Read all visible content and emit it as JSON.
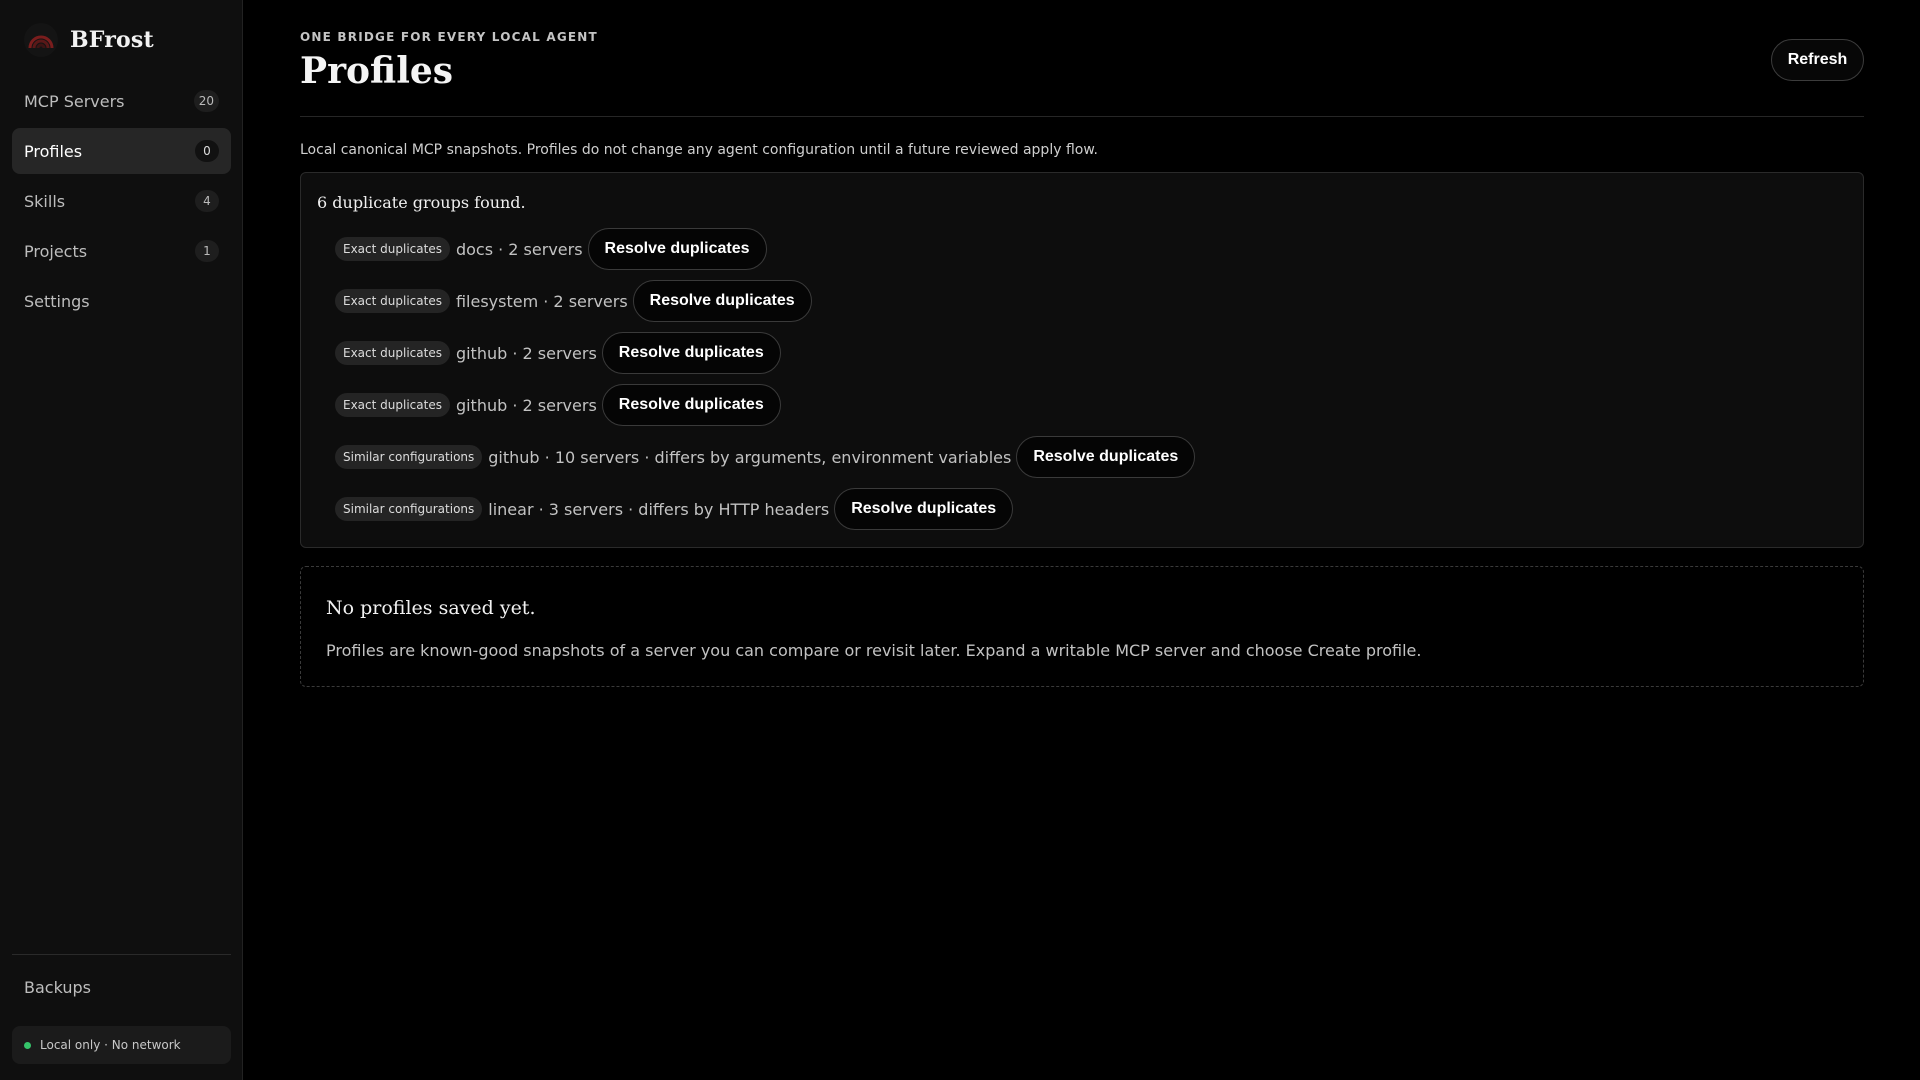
{
  "app": {
    "name": "BFrost",
    "logo_icon": "rainbow-arc-icon"
  },
  "sidebar": {
    "items": [
      {
        "label": "MCP Servers",
        "badge": "20",
        "active": false
      },
      {
        "label": "Profiles",
        "badge": "0",
        "active": true
      },
      {
        "label": "Skills",
        "badge": "4",
        "active": false
      },
      {
        "label": "Projects",
        "badge": "1",
        "active": false
      },
      {
        "label": "Settings",
        "badge": null,
        "active": false
      }
    ],
    "footer_link": "Backups",
    "status": {
      "text": "Local only · No network",
      "color": "#35c46a"
    }
  },
  "header": {
    "eyebrow": "ONE BRIDGE FOR EVERY LOCAL AGENT",
    "title": "Profiles",
    "refresh_label": "Refresh"
  },
  "main": {
    "intro": "Local canonical MCP snapshots. Profiles do not change any agent configuration until a future reviewed apply flow.",
    "duplicates": {
      "summary": "6 duplicate groups found.",
      "button_label": "Resolve duplicates",
      "groups": [
        {
          "tag": "Exact duplicates",
          "text": "docs · 2 servers"
        },
        {
          "tag": "Exact duplicates",
          "text": "filesystem · 2 servers"
        },
        {
          "tag": "Exact duplicates",
          "text": "github · 2 servers"
        },
        {
          "tag": "Exact duplicates",
          "text": "github · 2 servers"
        },
        {
          "tag": "Similar configurations",
          "text": "github · 10 servers · differs by arguments, environment variables"
        },
        {
          "tag": "Similar configurations",
          "text": "linear · 3 servers · differs by HTTP headers"
        }
      ]
    },
    "empty_state": {
      "title": "No profiles saved yet.",
      "body": "Profiles are known-good snapshots of a server you can compare or revisit later. Expand a writable MCP server and choose Create profile."
    }
  },
  "colors": {
    "background": "#000000",
    "sidebar": "#0f0f0f",
    "active_item": "#262626",
    "status_dot": "#35c46a"
  }
}
